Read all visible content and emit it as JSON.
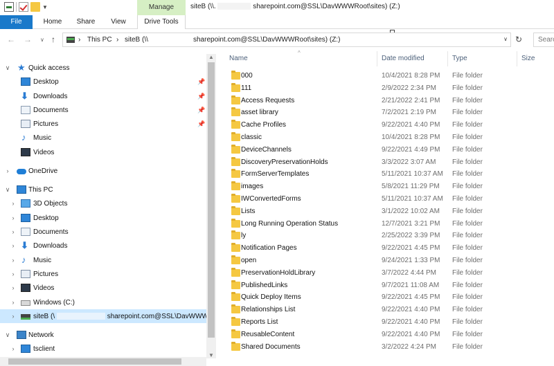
{
  "title_bar": {
    "manage_tab": "Manage",
    "title_prefix": "siteB (\\\\.",
    "title_suffix": "sharepoint.com@SSL\\DavWWWRoot\\sites) (Z:)"
  },
  "ribbon": {
    "tabs": [
      "File",
      "Home",
      "Share",
      "View",
      "Drive Tools"
    ]
  },
  "address": {
    "crumbs": [
      "This PC",
      "siteB (\\\\",
      "sharepoint.com@SSL\\DavWWWRoot\\sites) (Z:)"
    ],
    "search_placeholder": "Search"
  },
  "nav": {
    "quick_access": "Quick access",
    "quick_items": [
      "Desktop",
      "Downloads",
      "Documents",
      "Pictures",
      "Music",
      "Videos"
    ],
    "onedrive": "OneDrive",
    "this_pc": "This PC",
    "pc_items": [
      "3D Objects",
      "Desktop",
      "Documents",
      "Downloads",
      "Music",
      "Pictures",
      "Videos",
      "Windows (C:)"
    ],
    "siteb_prefix": "siteB (\\",
    "siteb_suffix": "sharepoint.com@SSL\\DavWWWR",
    "network": "Network",
    "tsclient": "tsclient"
  },
  "list": {
    "columns": [
      "Name",
      "Date modified",
      "Type",
      "Size"
    ],
    "rows": [
      {
        "name": "000",
        "date": "10/4/2021 8:28 PM",
        "type": "File folder"
      },
      {
        "name": "111",
        "date": "2/9/2022 2:34 PM",
        "type": "File folder"
      },
      {
        "name": "Access Requests",
        "date": "2/21/2022 2:41 PM",
        "type": "File folder"
      },
      {
        "name": "asset library",
        "date": "7/2/2021 2:19 PM",
        "type": "File folder"
      },
      {
        "name": "Cache Profiles",
        "date": "9/22/2021 4:40 PM",
        "type": "File folder"
      },
      {
        "name": "classic",
        "date": "10/4/2021 8:28 PM",
        "type": "File folder"
      },
      {
        "name": "DeviceChannels",
        "date": "9/22/2021 4:49 PM",
        "type": "File folder"
      },
      {
        "name": "DiscoveryPreservationHolds",
        "date": "3/3/2022 3:07 AM",
        "type": "File folder"
      },
      {
        "name": "FormServerTemplates",
        "date": "5/11/2021 10:37 AM",
        "type": "File folder"
      },
      {
        "name": "images",
        "date": "5/8/2021 11:29 PM",
        "type": "File folder"
      },
      {
        "name": "IWConvertedForms",
        "date": "5/11/2021 10:37 AM",
        "type": "File folder"
      },
      {
        "name": "Lists",
        "date": "3/1/2022 10:02 AM",
        "type": "File folder"
      },
      {
        "name": "Long Running Operation Status",
        "date": "12/7/2021 3:21 PM",
        "type": "File folder"
      },
      {
        "name": "ly",
        "date": "2/25/2022 3:39 PM",
        "type": "File folder"
      },
      {
        "name": "Notification Pages",
        "date": "9/22/2021 4:45 PM",
        "type": "File folder"
      },
      {
        "name": "open",
        "date": "9/24/2021 1:33 PM",
        "type": "File folder"
      },
      {
        "name": "PreservationHoldLibrary",
        "date": "3/7/2022 4:44 PM",
        "type": "File folder"
      },
      {
        "name": "PublishedLinks",
        "date": "9/7/2021 11:08 AM",
        "type": "File folder"
      },
      {
        "name": "Quick Deploy Items",
        "date": "9/22/2021 4:45 PM",
        "type": "File folder"
      },
      {
        "name": "Relationships List",
        "date": "9/22/2021 4:40 PM",
        "type": "File folder"
      },
      {
        "name": "Reports List",
        "date": "9/22/2021 4:40 PM",
        "type": "File folder"
      },
      {
        "name": "ReusableContent",
        "date": "9/22/2021 4:40 PM",
        "type": "File folder"
      },
      {
        "name": "Shared Documents",
        "date": "3/2/2022 4:24 PM",
        "type": "File folder"
      }
    ]
  },
  "colors": {
    "file_tab": "#1979ca",
    "manage_tab": "#d6efc4",
    "selection": "#cce8ff",
    "folder": "#f5c842"
  }
}
